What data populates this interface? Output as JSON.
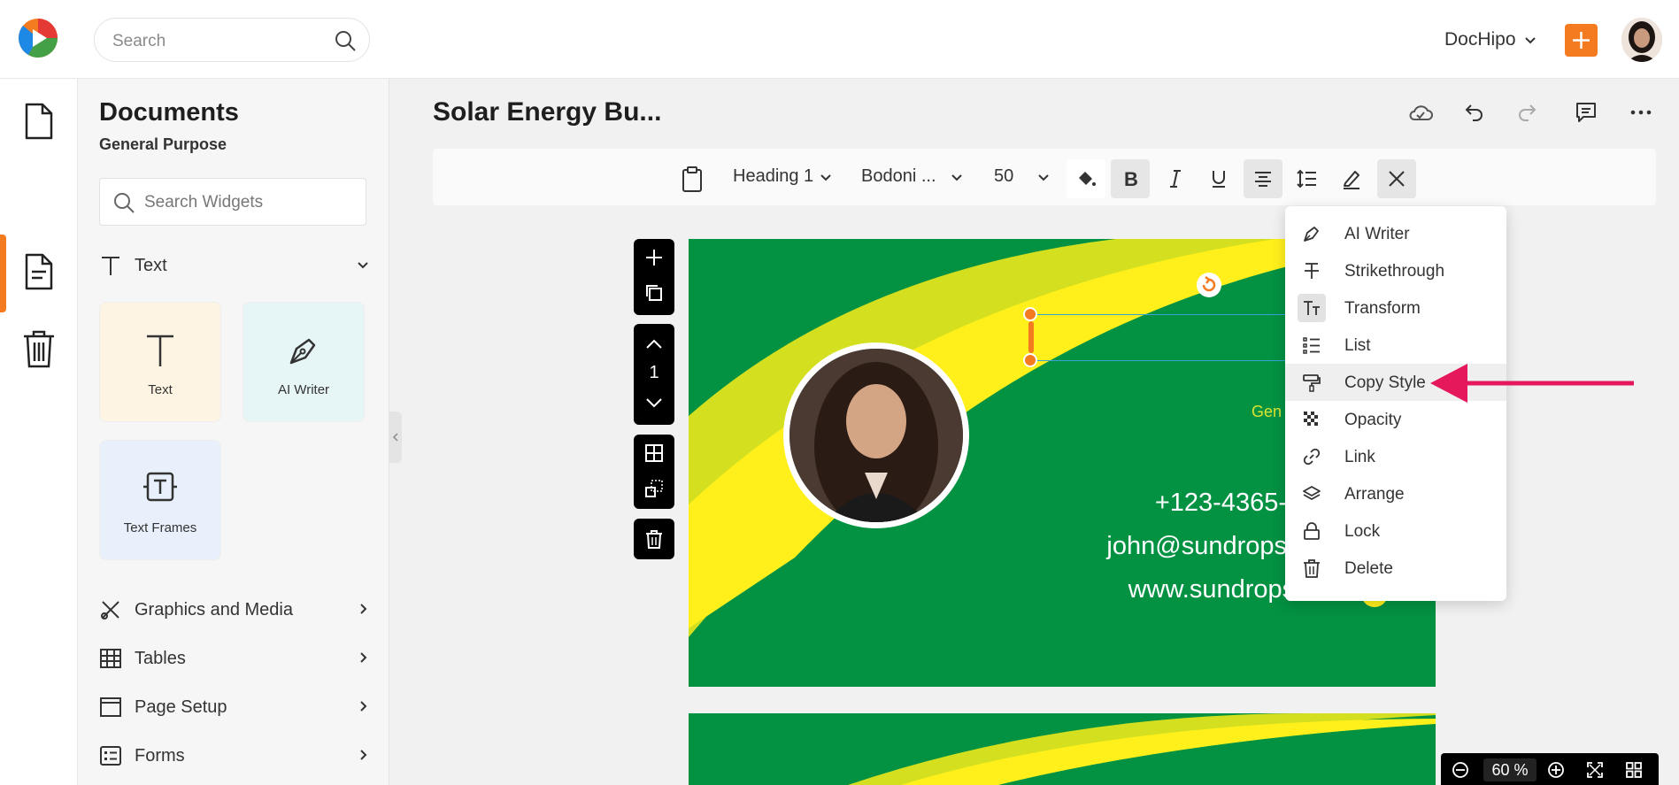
{
  "topbar": {
    "search_placeholder": "Search",
    "account_name": "DocHipo",
    "brand_color": "#f47b20"
  },
  "rail": {
    "items": [
      "documents-icon",
      "templates-icon",
      "trash-icon"
    ]
  },
  "panel": {
    "title": "Documents",
    "subtitle": "General Purpose",
    "search_placeholder": "Search Widgets",
    "text_section": "Text",
    "tiles": [
      {
        "label": "Text",
        "color": "#fdf4e3"
      },
      {
        "label": "AI Writer",
        "color": "#e6f5f5"
      },
      {
        "label": "Text Frames",
        "color": "#e8f1fb"
      }
    ],
    "sections": [
      "Graphics and Media",
      "Tables",
      "Page Setup",
      "Forms"
    ]
  },
  "editor": {
    "doc_title": "Solar Energy Bu...",
    "style": "Heading 1",
    "font": "Bodoni ...",
    "font_size": "50",
    "page_number": "1"
  },
  "canvas": {
    "gen_text": "Gen",
    "phone": "+123-4365-",
    "email": "john@sundrops",
    "website": "www.sundrops.com",
    "bg_color": "#039142",
    "swoosh_light": "#d4e01f",
    "swoosh_yellow": "#fff01c"
  },
  "menu": {
    "items": [
      {
        "label": "AI Writer",
        "icon": "pen-nib-icon"
      },
      {
        "label": "Strikethrough",
        "icon": "strikethrough-icon"
      },
      {
        "label": "Transform",
        "icon": "text-case-icon"
      },
      {
        "label": "List",
        "icon": "list-icon"
      },
      {
        "label": "Copy Style",
        "icon": "paint-roller-icon"
      },
      {
        "label": "Opacity",
        "icon": "checker-icon"
      },
      {
        "label": "Link",
        "icon": "link-icon"
      },
      {
        "label": "Arrange",
        "icon": "layers-icon"
      },
      {
        "label": "Lock",
        "icon": "lock-icon"
      },
      {
        "label": "Delete",
        "icon": "trash-icon"
      }
    ],
    "highlighted": "Copy Style"
  },
  "zoom": {
    "value": "60",
    "unit": "%"
  },
  "annotation_arrow_color": "#e5185c"
}
